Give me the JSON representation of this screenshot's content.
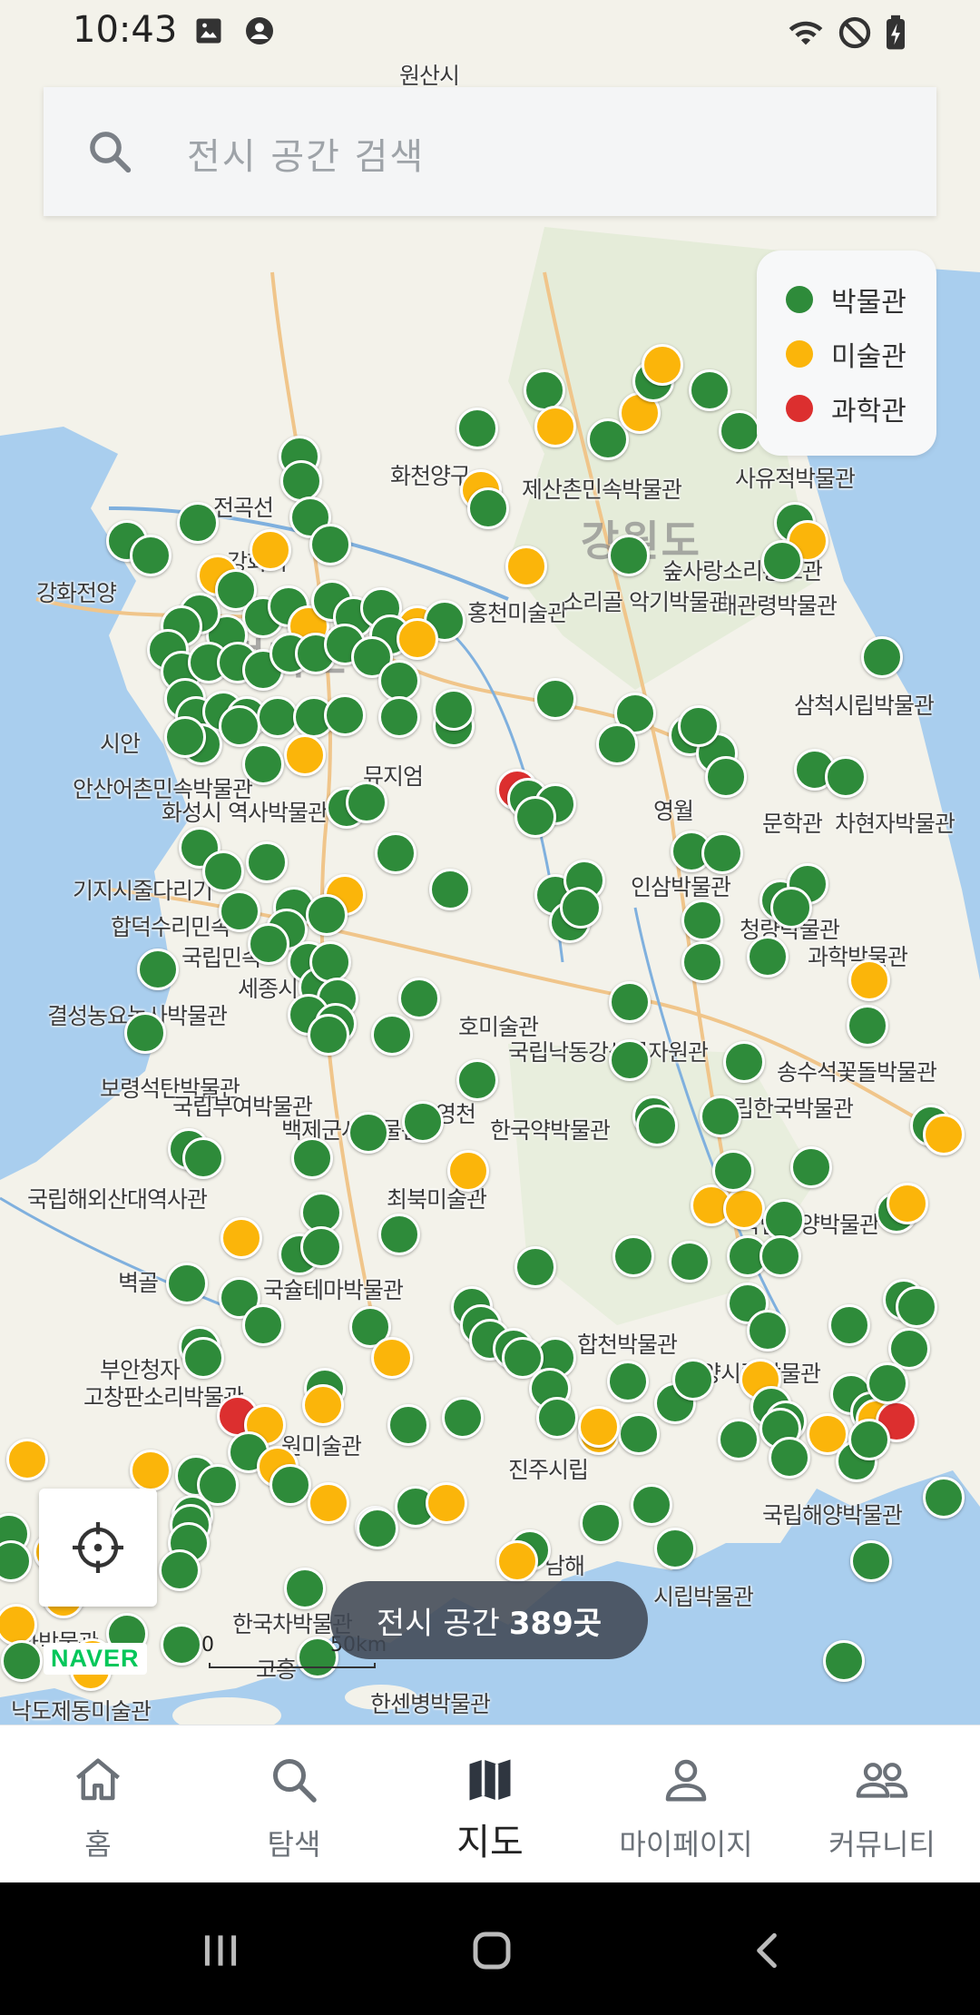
{
  "status_bar": {
    "time": "10:43"
  },
  "search": {
    "placeholder": "전시 공간 검색"
  },
  "legend": [
    {
      "label": "박물관",
      "color": "#2e8b3a"
    },
    {
      "label": "미술관",
      "color": "#fbb50a"
    },
    {
      "label": "과학관",
      "color": "#dc2f2f"
    }
  ],
  "map": {
    "region_labels": [
      "강원도",
      "경기도"
    ],
    "place_labels": [
      "원산시",
      "화천양구",
      "제산촌민속박물관",
      "사유적박물관",
      "전곡선",
      "강화전양",
      "강화시",
      "홍천미술관",
      "숲사랑소리홍보관",
      "소리골 악기박물관",
      "태관령박물관",
      "삼척시립박물관",
      "뮤지엄",
      "안산어촌민속박물관",
      "화성시 역사박물관",
      "시안",
      "영월",
      "문학관",
      "차현자박물관",
      "인삼박물관",
      "청량박물관",
      "과학박물관",
      "기지시줄다리기",
      "합덕수리민속",
      "세종시",
      "국립민속",
      "결성농요농사박물관",
      "보령석탄박물관",
      "국립부여박물관",
      "백제군사박물관",
      "영천",
      "호미술관",
      "국립낙동강생물자원관",
      "송수석꽃돌박물관",
      "국립한국박물관",
      "한국약박물관",
      "국립해양박물관",
      "국립해외산대역사관",
      "최북미술관",
      "벽골",
      "국슐테마박물관",
      "부안청자",
      "고창판소리박물관",
      "합천박물관",
      "밀양시립박물관",
      "원미술관",
      "진주시립",
      "국립해양박물관",
      "남해",
      "시립박물관",
      "한국차박물관",
      "한센병박물관",
      "고흥",
      "과박물관",
      "낙도제동미술관"
    ],
    "attribution": "NAVER",
    "scale": {
      "zero": "0",
      "distance": "50km"
    }
  },
  "count_pill": {
    "prefix": "전시 공간",
    "count": "389곳"
  },
  "bottom_nav": [
    {
      "label": "홈",
      "icon": "home-icon",
      "active": false
    },
    {
      "label": "탐색",
      "icon": "search-icon",
      "active": false
    },
    {
      "label": "지도",
      "icon": "map-icon",
      "active": true
    },
    {
      "label": "마이페이지",
      "icon": "person-icon",
      "active": false
    },
    {
      "label": "커뮤니티",
      "icon": "people-icon",
      "active": false
    }
  ]
}
